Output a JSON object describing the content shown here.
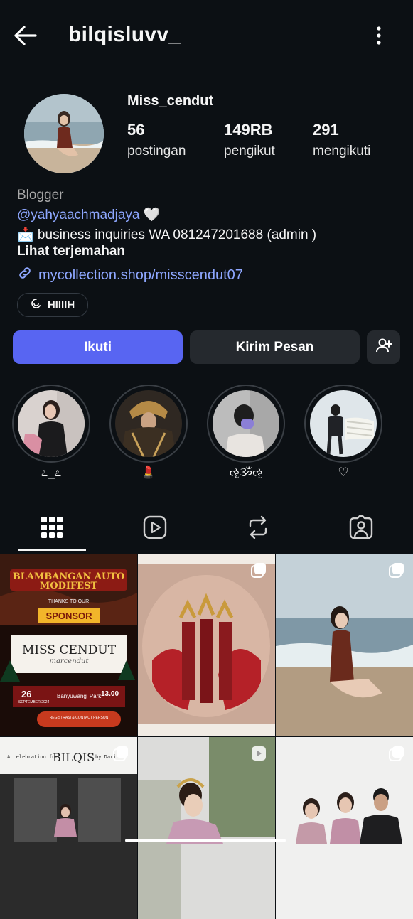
{
  "header": {
    "username": "bilqisluvv_",
    "back_icon": "arrow-left-icon",
    "more_icon": "more-vertical-icon"
  },
  "profile": {
    "display_name": "Miss_cendut",
    "stats": [
      {
        "value": "56",
        "label": "postingan"
      },
      {
        "value": "149RB",
        "label": "pengikut"
      },
      {
        "value": "291",
        "label": "mengikuti"
      }
    ],
    "category": "Blogger",
    "mention": "@yahyaachmadjaya 🤍",
    "bio_line": "📩 business inquiries WA 081247201688 (admin )",
    "translate_label": "Lihat terjemahan",
    "link": "mycollection.shop/misscendut07",
    "threads_badge": "HIIIIH"
  },
  "actions": {
    "follow": "Ikuti",
    "message": "Kirim Pesan",
    "add_user_icon": "add-user-icon"
  },
  "highlights": [
    {
      "label": "೭_೭"
    },
    {
      "label": "💄"
    },
    {
      "label": "ૡૐૡ"
    },
    {
      "label": "♡"
    }
  ],
  "tabs": [
    "grid-icon",
    "reels-icon",
    "reposts-icon",
    "tagged-icon"
  ],
  "grid": {
    "post1": {
      "banner_title": "BLAMBANGAN AUTO MODIFEST",
      "banner_sub": "THANKS TO OUR",
      "sponsor": "SPONSOR",
      "name": "MISS CENDUT",
      "script": "marcendut",
      "date_day": "26",
      "date_month": "SEPTEMBER 2024",
      "venue": "Banyuwangi Park",
      "time": "13.00",
      "contact": "REGISTRASI & CONTACT PERSON"
    },
    "post4": {
      "intro": "A celebration for",
      "name": "BILQIS",
      "by": "by Dari"
    }
  },
  "colors": {
    "background": "#0c1014",
    "accent": "#5865f2",
    "link": "#8ea7ff",
    "button_dark": "#25292e"
  }
}
